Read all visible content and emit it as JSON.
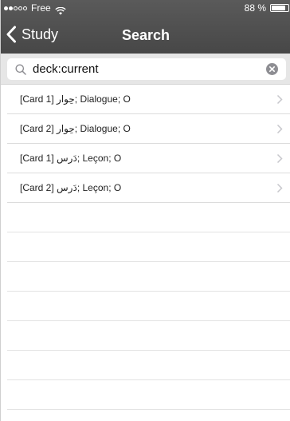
{
  "status": {
    "carrier": "Free",
    "battery": "88 %",
    "battery_level": 0.88
  },
  "nav": {
    "back_label": "Study",
    "title": "Search"
  },
  "search": {
    "value": "deck:current",
    "placeholder": ""
  },
  "results": [
    {
      "card": "[Card 1]",
      "word": "حِوار",
      "rest": "; Dialogue; O"
    },
    {
      "card": "[Card 2]",
      "word": "حِوار",
      "rest": "; Dialogue; O"
    },
    {
      "card": "[Card 1]",
      "word": "دَرس",
      "rest": "; Leçon; O"
    },
    {
      "card": "[Card 2]",
      "word": "دَرس",
      "rest": "; Leçon; O"
    }
  ]
}
